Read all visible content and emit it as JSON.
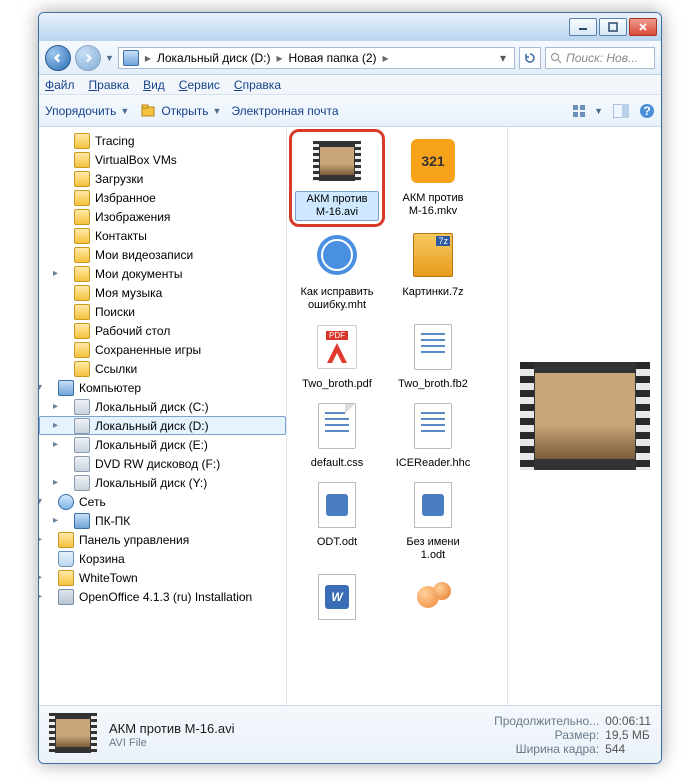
{
  "titlebar": {
    "min": "_",
    "max": "□",
    "close": "×"
  },
  "breadcrumbs": [
    "Локальный диск (D:)",
    "Новая папка (2)"
  ],
  "search_placeholder": "Поиск: Нов...",
  "menus": [
    "Файл",
    "Правка",
    "Вид",
    "Сервис",
    "Справка"
  ],
  "toolbar": {
    "organize": "Упорядочить",
    "open": "Открыть",
    "email": "Электронная почта"
  },
  "tree": [
    {
      "label": "Tracing",
      "icon": "folder",
      "depth": 1
    },
    {
      "label": "VirtualBox VMs",
      "icon": "folder",
      "depth": 1
    },
    {
      "label": "Загрузки",
      "icon": "folder",
      "depth": 1
    },
    {
      "label": "Избранное",
      "icon": "folder",
      "depth": 1
    },
    {
      "label": "Изображения",
      "icon": "folder",
      "depth": 1
    },
    {
      "label": "Контакты",
      "icon": "folder",
      "depth": 1
    },
    {
      "label": "Мои видеозаписи",
      "icon": "folder",
      "depth": 1
    },
    {
      "label": "Мои документы",
      "icon": "folder",
      "depth": 1,
      "exp": "▸"
    },
    {
      "label": "Моя музыка",
      "icon": "folder",
      "depth": 1
    },
    {
      "label": "Поиски",
      "icon": "folder",
      "depth": 1
    },
    {
      "label": "Рабочий стол",
      "icon": "folder",
      "depth": 1
    },
    {
      "label": "Сохраненные игры",
      "icon": "folder",
      "depth": 1
    },
    {
      "label": "Ссылки",
      "icon": "folder",
      "depth": 1
    },
    {
      "label": "Компьютер",
      "icon": "comp",
      "depth": 0,
      "exp": "▾"
    },
    {
      "label": "Локальный диск (C:)",
      "icon": "disk",
      "depth": 1,
      "exp": "▸"
    },
    {
      "label": "Локальный диск (D:)",
      "icon": "disk",
      "depth": 1,
      "exp": "▸",
      "sel": true
    },
    {
      "label": "Локальный диск (E:)",
      "icon": "disk",
      "depth": 1,
      "exp": "▸"
    },
    {
      "label": "DVD RW дисковод (F:)",
      "icon": "disk",
      "depth": 1
    },
    {
      "label": "Локальный диск (Y:)",
      "icon": "disk",
      "depth": 1,
      "exp": "▸"
    },
    {
      "label": "Сеть",
      "icon": "net",
      "depth": 0,
      "exp": "▾"
    },
    {
      "label": "ПК-ПК",
      "icon": "comp",
      "depth": 1,
      "exp": "▸"
    },
    {
      "label": "Панель управления",
      "icon": "folder",
      "depth": 0,
      "exp": "▸"
    },
    {
      "label": "Корзина",
      "icon": "bin",
      "depth": 0
    },
    {
      "label": "WhiteTown",
      "icon": "folder",
      "depth": 0,
      "exp": "▸"
    },
    {
      "label": "OpenOffice 4.1.3 (ru) Installation",
      "icon": "oo",
      "depth": 0,
      "exp": "▸"
    }
  ],
  "files": [
    {
      "label": "АКМ против М-16.avi",
      "type": "film",
      "sel": true,
      "hl": true
    },
    {
      "label": "АКМ против М-16.mkv",
      "type": "mpc"
    },
    {
      "label": "Как исправить ошибку.mht",
      "type": "html"
    },
    {
      "label": "Картинки.7z",
      "type": "archive"
    },
    {
      "label": "Two_broth.pdf",
      "type": "pdf"
    },
    {
      "label": "Two_broth.fb2",
      "type": "page"
    },
    {
      "label": "default.css",
      "type": "pagefold"
    },
    {
      "label": "ICEReader.hhc",
      "type": "page"
    },
    {
      "label": "ODT.odt",
      "type": "odt"
    },
    {
      "label": "Без имени 1.odt",
      "type": "odt"
    },
    {
      "label": "",
      "type": "word"
    },
    {
      "label": "",
      "type": "peach"
    }
  ],
  "details": {
    "name": "АКМ против М-16.avi",
    "type": "AVI File",
    "meta": [
      {
        "k": "Продолжительно...",
        "v": "00:06:11"
      },
      {
        "k": "Размер:",
        "v": "19,5 МБ"
      },
      {
        "k": "Ширина кадра:",
        "v": "544"
      }
    ]
  }
}
